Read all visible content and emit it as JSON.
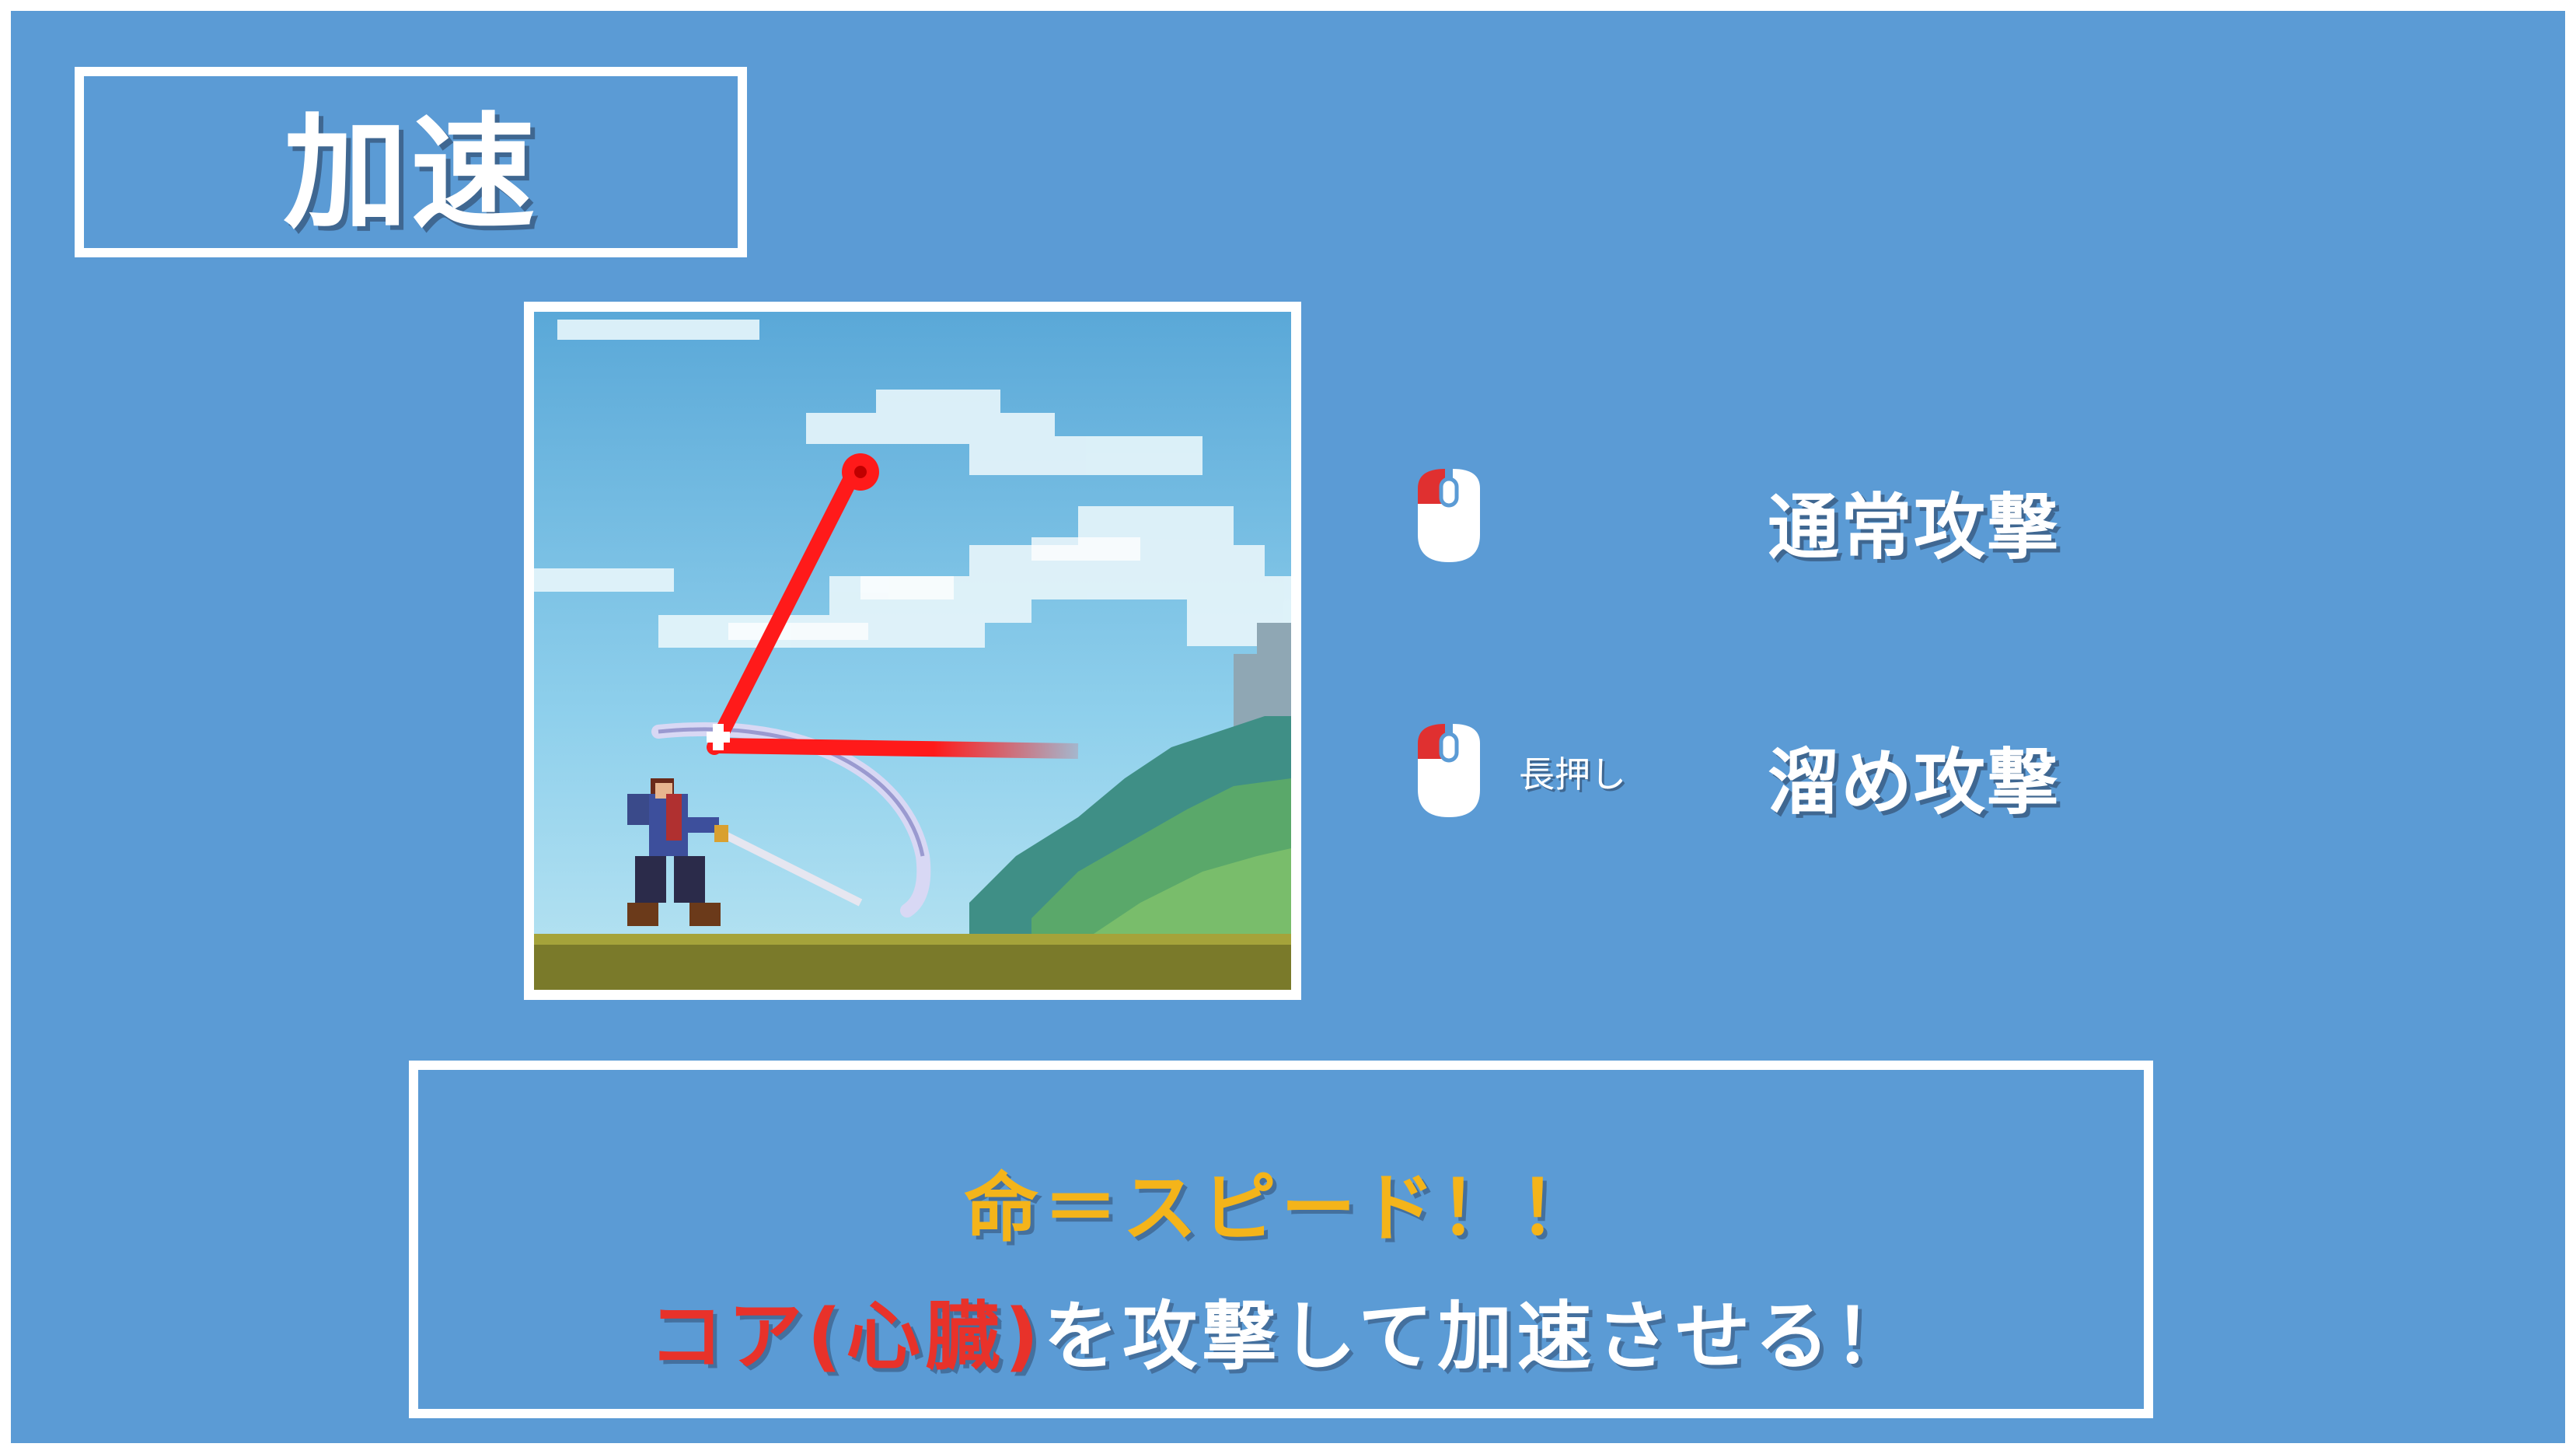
{
  "title": "加速",
  "controls": [
    {
      "button_icon": "left-mouse-button-icon",
      "modifier": "",
      "action": "通常攻撃"
    },
    {
      "button_icon": "left-mouse-button-icon",
      "modifier": "長押し",
      "action": "溜め攻撃"
    }
  ],
  "hint": {
    "line1": "命＝スピード！！",
    "line2_highlight": "コア(心臓)",
    "line2_rest": "を攻撃して加速させる！"
  },
  "colors": {
    "background": "#5b9bd5",
    "frame": "#ffffff",
    "highlight_yellow": "#f4b41a",
    "highlight_red": "#e8322a",
    "mouse_button_red": "#e03030"
  }
}
